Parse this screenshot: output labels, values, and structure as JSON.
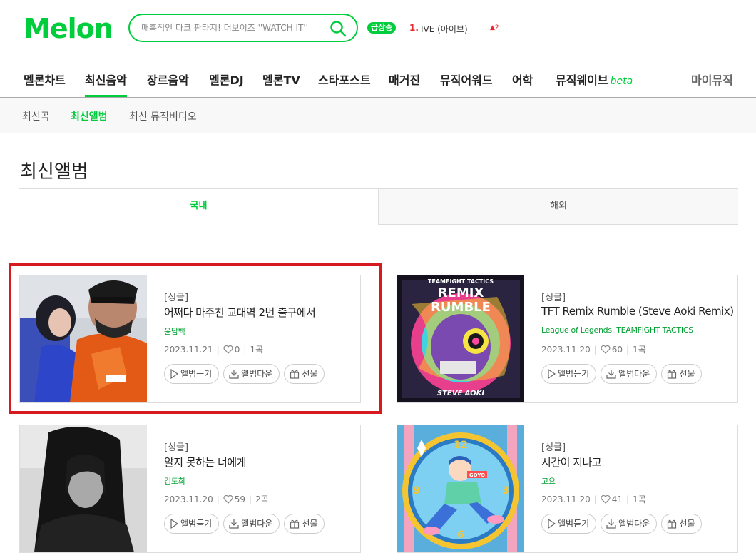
{
  "header": {
    "logo": "Melon",
    "search_placeholder": "매혹적인 다크 판타지! 더보이즈 ''WATCH IT''",
    "rising_badge": "급상승",
    "rank_number": "1.",
    "rank_name": "IVE (아이브)",
    "rank_change": "2",
    "brand_color": "#00cd3c"
  },
  "gnb": {
    "items": [
      "멜론차트",
      "최신음악",
      "장르음악",
      "멜론DJ",
      "멜론TV",
      "스타포스트",
      "매거진",
      "뮤직어워드",
      "어학",
      "뮤직웨이브"
    ],
    "beta": "beta",
    "my_music": "마이뮤직",
    "active_index": 1
  },
  "subnav": {
    "items": [
      "최신곡",
      "최신앨범",
      "최신 뮤직비디오"
    ],
    "active_index": 1
  },
  "page_title": "최신앨범",
  "tabs": {
    "domestic": "국내",
    "overseas": "해외"
  },
  "buttons": {
    "listen": "앨범듣기",
    "download": "앨범다운",
    "gift": "선물"
  },
  "albums": [
    {
      "type": "[싱글]",
      "title": "어쩌다 마주친 교대역 2번 출구에서",
      "artist": "윤담백",
      "date": "2023.11.21",
      "likes": "0",
      "tracks": "1곡"
    },
    {
      "type": "[싱글]",
      "title": "TFT Remix Rumble (Steve Aoki Remix)",
      "artist": "League of Legends, TEAMFIGHT TACTICS",
      "date": "2023.11.20",
      "likes": "60",
      "tracks": "1곡",
      "cover_text": [
        "TEAMFIGHT TACTICS",
        "REMIX",
        "RUMBLE",
        "STEVE AOKI"
      ]
    },
    {
      "type": "[싱글]",
      "title": "알지 못하는 너에게",
      "artist": "김도희",
      "date": "2023.11.20",
      "likes": "59",
      "tracks": "2곡"
    },
    {
      "type": "[싱글]",
      "title": "시간이 지나고",
      "artist": "고요",
      "date": "2023.11.20",
      "likes": "41",
      "tracks": "1곡",
      "cover_text": [
        "GOYO",
        "12",
        "3",
        "6",
        "9"
      ]
    }
  ]
}
